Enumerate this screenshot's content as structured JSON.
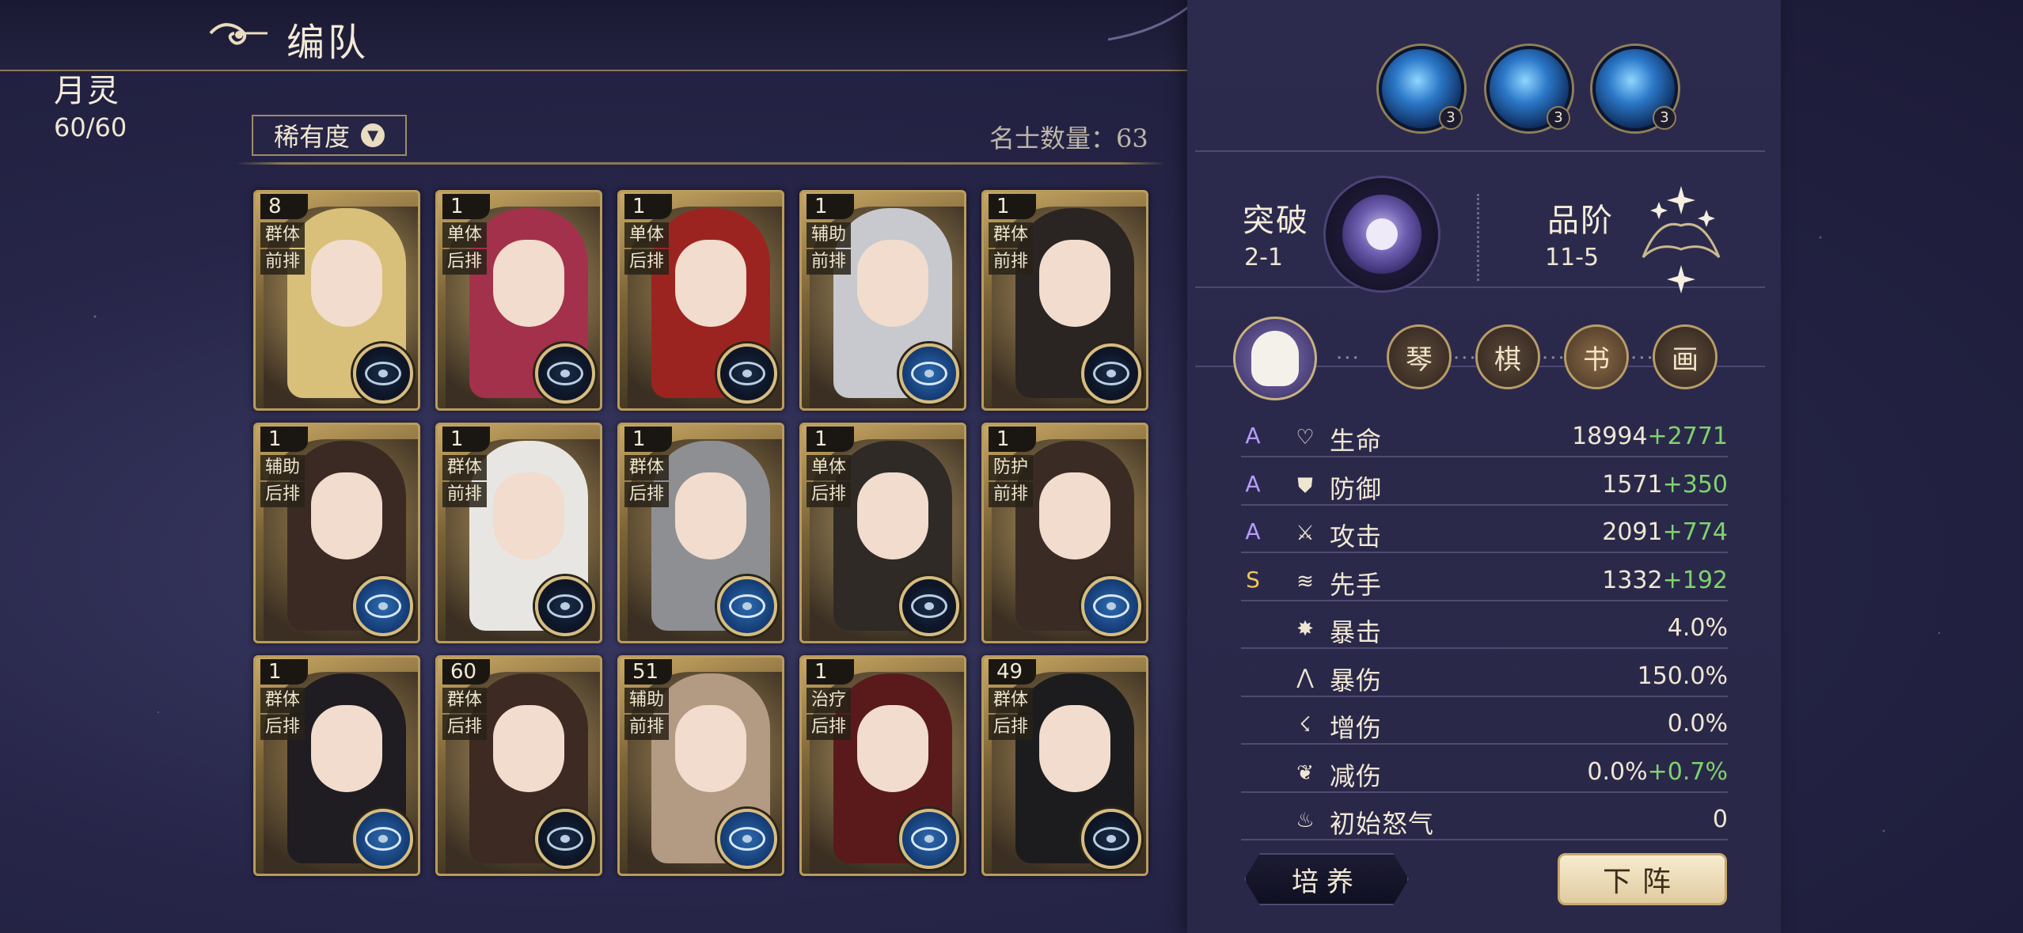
{
  "header": {
    "title": "编队",
    "logo_icon": "cloud-swirl-icon"
  },
  "filter": {
    "label": "稀有度",
    "chevron_icon": "chevron-down-icon"
  },
  "roster": {
    "count_label": "名士数量：63",
    "cards": [
      {
        "level": "8",
        "role": "群体",
        "position": "前排",
        "badge": "dark",
        "hair": "#d8c07a",
        "bg": "#c9a865"
      },
      {
        "level": "1",
        "role": "单体",
        "position": "后排",
        "badge": "dark",
        "hair": "#a3314c",
        "bg": "#b99c62"
      },
      {
        "level": "1",
        "role": "单体",
        "position": "后排",
        "badge": "dark",
        "hair": "#9c2420",
        "bg": "#a88a55"
      },
      {
        "level": "1",
        "role": "辅助",
        "position": "前排",
        "badge": "blue",
        "hair": "#c8c8cf",
        "bg": "#b09560"
      },
      {
        "level": "1",
        "role": "群体",
        "position": "前排",
        "badge": "dark",
        "hair": "#2a2423",
        "bg": "#b89a60"
      },
      {
        "level": "1",
        "role": "辅助",
        "position": "后排",
        "badge": "blue",
        "hair": "#3b2a24",
        "bg": "#a98c55"
      },
      {
        "level": "1",
        "role": "群体",
        "position": "前排",
        "badge": "dark",
        "hair": "#e8e6e3",
        "bg": "#b6995f"
      },
      {
        "level": "1",
        "role": "群体",
        "position": "后排",
        "badge": "blue",
        "hair": "#8d8f93",
        "bg": "#a88b55"
      },
      {
        "level": "1",
        "role": "单体",
        "position": "后排",
        "badge": "dark",
        "hair": "#2f2a26",
        "bg": "#b49a66"
      },
      {
        "level": "1",
        "role": "防护",
        "position": "前排",
        "badge": "blue",
        "hair": "#3a2b24",
        "bg": "#bd9f61"
      },
      {
        "level": "1",
        "role": "群体",
        "position": "后排",
        "badge": "blue",
        "hair": "#1f1c22",
        "bg": "#a98b54"
      },
      {
        "level": "60",
        "role": "群体",
        "position": "后排",
        "badge": "dark",
        "hair": "#3d2a22",
        "bg": "#b49660"
      },
      {
        "level": "51",
        "role": "辅助",
        "position": "前排",
        "badge": "blue",
        "hair": "#b39a83",
        "bg": "#a98c58"
      },
      {
        "level": "1",
        "role": "治疗",
        "position": "后排",
        "badge": "blue",
        "hair": "#5a1a1c",
        "bg": "#b89a62"
      },
      {
        "level": "49",
        "role": "群体",
        "position": "后排",
        "badge": "dark",
        "hair": "#1c1c1e",
        "bg": "#a98b55"
      }
    ]
  },
  "panel": {
    "name": "月灵",
    "energy": "60/60",
    "skills": [
      {
        "icon": "blade-slash-skill-icon",
        "level": "3"
      },
      {
        "icon": "light-pillar-skill-icon",
        "level": "3"
      },
      {
        "icon": "sword-dash-skill-icon",
        "level": "3"
      }
    ],
    "breakthrough": {
      "label": "突破",
      "value": "2-1",
      "icon": "planet-orb-icon"
    },
    "rank": {
      "label": "品阶",
      "value": "11-5",
      "icon": "sparkle-crest-icon"
    },
    "arts": {
      "avatar_icon": "goat-avatar-icon",
      "items": [
        {
          "label": "琴",
          "active": false
        },
        {
          "label": "棋",
          "active": false
        },
        {
          "label": "书",
          "active": true
        },
        {
          "label": "画",
          "active": false
        }
      ]
    },
    "stats": [
      {
        "grade": "A",
        "grade_color": "#b79cff",
        "icon": "heart-icon",
        "label": "生命",
        "base": "18994",
        "bonus": "+2771"
      },
      {
        "grade": "A",
        "grade_color": "#b79cff",
        "icon": "shield-icon",
        "label": "防御",
        "base": "1571",
        "bonus": "+350"
      },
      {
        "grade": "A",
        "grade_color": "#b79cff",
        "icon": "sword-icon",
        "label": "攻击",
        "base": "2091",
        "bonus": "+774"
      },
      {
        "grade": "S",
        "grade_color": "#f0c75a",
        "icon": "wind-icon",
        "label": "先手",
        "base": "1332",
        "bonus": "+192"
      },
      {
        "grade": "",
        "grade_color": "",
        "icon": "burst-icon",
        "label": "暴击",
        "base": "4.0%",
        "bonus": ""
      },
      {
        "grade": "",
        "grade_color": "",
        "icon": "spikes-icon",
        "label": "暴伤",
        "base": "150.0%",
        "bonus": ""
      },
      {
        "grade": "",
        "grade_color": "",
        "icon": "claw-icon",
        "label": "增伤",
        "base": "0.0%",
        "bonus": ""
      },
      {
        "grade": "",
        "grade_color": "",
        "icon": "wing-icon",
        "label": "减伤",
        "base": "0.0%",
        "bonus": "+0.7%"
      },
      {
        "grade": "",
        "grade_color": "",
        "icon": "flame-icon",
        "label": "初始怒气",
        "base": "0",
        "bonus": ""
      }
    ],
    "buttons": {
      "train": "培养",
      "remove": "下阵"
    }
  }
}
